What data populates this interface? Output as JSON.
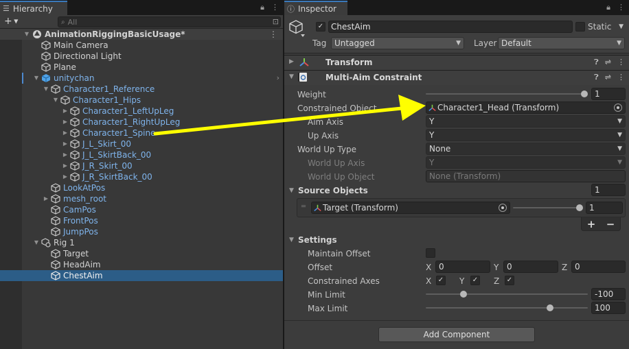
{
  "hierarchy": {
    "tab_label": "Hierarchy",
    "search_placeholder": "All",
    "scene_name": "AnimationRiggingBasicUsage*",
    "items": [
      {
        "label": "Main Camera"
      },
      {
        "label": "Directional Light"
      },
      {
        "label": "Plane"
      },
      {
        "label": "unitychan"
      },
      {
        "label": "Character1_Reference"
      },
      {
        "label": "Character1_Hips"
      },
      {
        "label": "Character1_LeftUpLeg"
      },
      {
        "label": "Character1_RightUpLeg"
      },
      {
        "label": "Character1_Spine"
      },
      {
        "label": "J_L_Skirt_00"
      },
      {
        "label": "J_L_SkirtBack_00"
      },
      {
        "label": "J_R_Skirt_00"
      },
      {
        "label": "J_R_SkirtBack_00"
      },
      {
        "label": "LookAtPos"
      },
      {
        "label": "mesh_root"
      },
      {
        "label": "CamPos"
      },
      {
        "label": "FrontPos"
      },
      {
        "label": "JumpPos"
      },
      {
        "label": "Rig 1"
      },
      {
        "label": "Target"
      },
      {
        "label": "HeadAim"
      },
      {
        "label": "ChestAim"
      }
    ]
  },
  "inspector": {
    "tab_label": "Inspector",
    "object_name": "ChestAim",
    "static_label": "Static",
    "tag_label": "Tag",
    "tag_value": "Untagged",
    "layer_label": "Layer",
    "layer_value": "Default",
    "transform_title": "Transform",
    "constraint_title": "Multi-Aim Constraint",
    "weight_label": "Weight",
    "weight_value": "1",
    "constrained_object_label": "Constrained Object",
    "constrained_object_value": "Character1_Head (Transform)",
    "aim_axis_label": "Aim Axis",
    "aim_axis_value": "Y",
    "up_axis_label": "Up Axis",
    "up_axis_value": "Y",
    "world_up_type_label": "World Up Type",
    "world_up_type_value": "None",
    "world_up_axis_label": "World Up Axis",
    "world_up_axis_value": "Y",
    "world_up_object_label": "World Up Object",
    "world_up_object_value": "None (Transform)",
    "source_objects_label": "Source Objects",
    "source_objects_count": "1",
    "source_target_value": "Target (Transform)",
    "source_weight_value": "1",
    "plus_label": "+",
    "minus_label": "−",
    "settings_label": "Settings",
    "maintain_offset_label": "Maintain Offset",
    "offset_label": "Offset",
    "offset_x": "0",
    "offset_y": "0",
    "offset_z": "0",
    "x_label": "X",
    "y_label": "Y",
    "z_label": "Z",
    "constrained_axes_label": "Constrained Axes",
    "min_limit_label": "Min Limit",
    "min_limit_value": "-100",
    "max_limit_label": "Max Limit",
    "max_limit_value": "100",
    "add_component_label": "Add Component"
  },
  "annotation": {
    "color": "#ffff00"
  }
}
